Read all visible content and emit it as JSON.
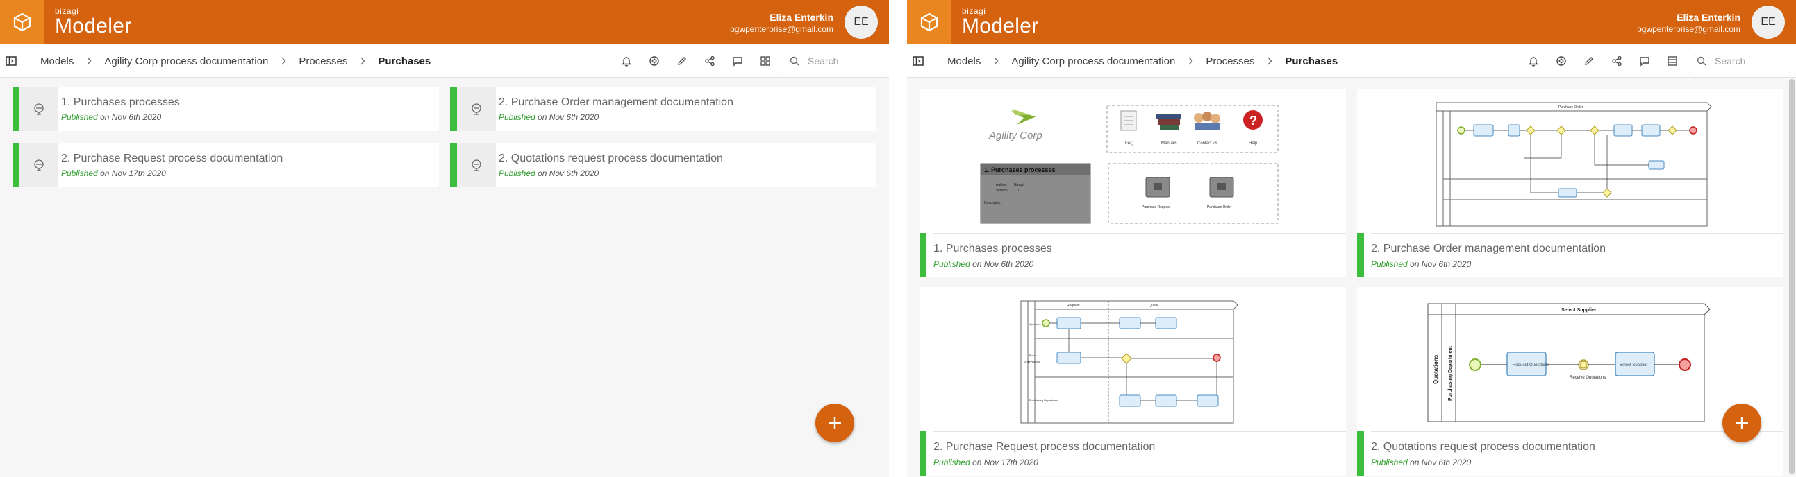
{
  "app": {
    "brand_small": "bizagi",
    "brand_name": "Modeler",
    "user_name": "Eliza Enterkin",
    "user_email": "bgwpenterprise@gmail.com",
    "avatar_initials": "EE",
    "accent_color": "#d4620f",
    "published_color": "#3cbd3b"
  },
  "breadcrumb": [
    "Models",
    "Agility Corp process documentation",
    "Processes",
    "Purchases"
  ],
  "search": {
    "placeholder": "Search"
  },
  "toolbar_icons": [
    "bell-icon",
    "tag-icon",
    "pencil-icon",
    "share-icon",
    "comment-icon",
    "view-toggle-icon"
  ],
  "processes": [
    {
      "title": "1. Purchases processes",
      "status": "Published",
      "date": "on Nov 6th 2020"
    },
    {
      "title": "2. Purchase Order management documentation",
      "status": "Published",
      "date": "on Nov 6th 2020"
    },
    {
      "title": "2. Purchase Request process documentation",
      "status": "Published",
      "date": "on Nov 17th 2020"
    },
    {
      "title": "2. Quotations request process documentation",
      "status": "Published",
      "date": "on Nov 6th 2020"
    }
  ],
  "previews": {
    "agility": {
      "logo_text": "Agility Corp",
      "icons": [
        "FAQ",
        "Manuals",
        "Contact us",
        "Help"
      ],
      "box_title": "1. Purchases processes",
      "box_author_label": "Author:",
      "box_author": "Bizagi",
      "box_version_label": "Version:",
      "box_version": "1.0",
      "box_desc_label": "Description:",
      "links": [
        "Purchase Request",
        "Purchase Order"
      ]
    },
    "order": {
      "title": "Purchase Order"
    },
    "request": {
      "lane_group": "Purchases",
      "lanes": [
        "Applicant",
        "Boss",
        "Purchasing Department"
      ],
      "phases": [
        "Request",
        "Quote"
      ]
    },
    "quotations": {
      "title": "Select Supplier",
      "pool": "Quotations",
      "lane": "Purchasing Department",
      "task1": "Request Quotations",
      "event": "Receive Quotations",
      "task2": "Select Supplier"
    }
  }
}
